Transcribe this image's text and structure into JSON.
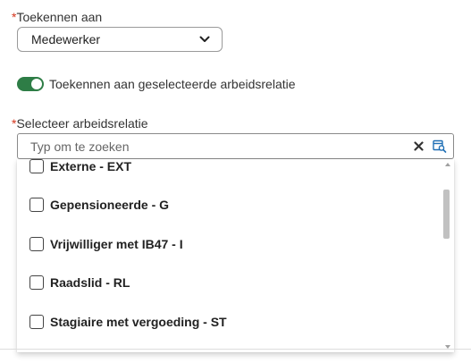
{
  "assign_to": {
    "required_mark": "*",
    "label": "Toekennen aan",
    "selected": "Medewerker",
    "icon": "chevron-down-icon"
  },
  "toggle": {
    "on": true,
    "color": "#2e7d46",
    "label": "Toekennen aan geselecteerde arbeidsrelatie"
  },
  "relation": {
    "required_mark": "*",
    "label": "Selecteer arbeidsrelatie",
    "search_placeholder": "Typ om te zoeken",
    "clear_icon": "close-icon",
    "lookup_icon": "search-list-icon",
    "options": [
      {
        "label": "Externe - EXT",
        "checked": false
      },
      {
        "label": "Gepensioneerde - G",
        "checked": false
      },
      {
        "label": "Vrijwilliger met IB47 - I",
        "checked": false
      },
      {
        "label": "Raadslid - RL",
        "checked": false
      },
      {
        "label": "Stagiaire met vergoeding - ST",
        "checked": false
      }
    ]
  },
  "colors": {
    "required": "#d4351c",
    "accent_blue": "#1f6fb5"
  }
}
